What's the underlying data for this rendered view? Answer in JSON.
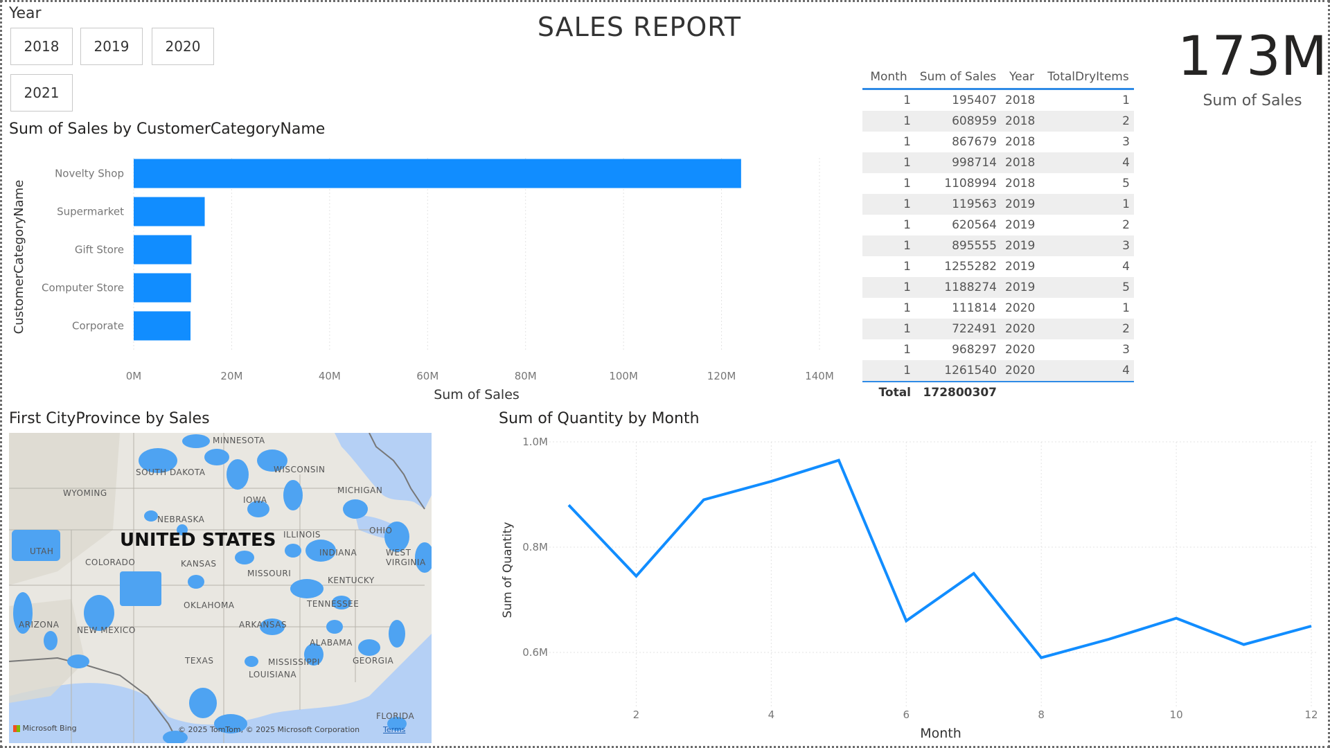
{
  "slicer": {
    "title": "Year",
    "options": [
      "2018",
      "2019",
      "2020",
      "2021"
    ]
  },
  "report": {
    "title": "SALES REPORT"
  },
  "kpi": {
    "value": "173M",
    "label": "Sum of Sales"
  },
  "bar_visual": {
    "title": "Sum of Sales by CustomerCategoryName"
  },
  "table": {
    "headers": [
      "Month",
      "Sum of Sales",
      "Year",
      "TotalDryItems"
    ],
    "rows": [
      [
        "1",
        "195407",
        "2018",
        "1"
      ],
      [
        "1",
        "608959",
        "2018",
        "2"
      ],
      [
        "1",
        "867679",
        "2018",
        "3"
      ],
      [
        "1",
        "998714",
        "2018",
        "4"
      ],
      [
        "1",
        "1108994",
        "2018",
        "5"
      ],
      [
        "1",
        "119563",
        "2019",
        "1"
      ],
      [
        "1",
        "620564",
        "2019",
        "2"
      ],
      [
        "1",
        "895555",
        "2019",
        "3"
      ],
      [
        "1",
        "1255282",
        "2019",
        "4"
      ],
      [
        "1",
        "1188274",
        "2019",
        "5"
      ],
      [
        "1",
        "111814",
        "2020",
        "1"
      ],
      [
        "1",
        "722491",
        "2020",
        "2"
      ],
      [
        "1",
        "968297",
        "2020",
        "3"
      ],
      [
        "1",
        "1261540",
        "2020",
        "4"
      ]
    ],
    "total_label": "Total",
    "total_value": "172800307"
  },
  "map": {
    "title": "First CityProvince by Sales",
    "country_label": "UNITED STATES",
    "state_labels": [
      "MINNESOTA",
      "SOUTH DAKOTA",
      "WISCONSIN",
      "WYOMING",
      "IOWA",
      "MICHIGAN",
      "NEBRASKA",
      "ILLINOIS",
      "OHIO",
      "UTAH",
      "COLORADO",
      "KANSAS",
      "INDIANA",
      "WEST VIRGINIA",
      "MISSOURI",
      "KENTUCKY",
      "OKLAHOMA",
      "TENNESSEE",
      "ARIZONA",
      "NEW MEXICO",
      "ARKANSAS",
      "ALABAMA",
      "TEXAS",
      "MISSISSIPPI",
      "GEORGIA",
      "LOUISIANA",
      "FLORIDA"
    ],
    "logo": "Microsoft Bing",
    "credit": "© 2025 TomTom, © 2025 Microsoft Corporation",
    "terms": "Terms"
  },
  "line_visual": {
    "title": "Sum of Quantity by Month"
  },
  "colors": {
    "accent": "#118dff",
    "header_rule": "#2e8ae6",
    "map_fill": "#4ea3f2"
  },
  "chart_data": [
    {
      "type": "bar",
      "orientation": "horizontal",
      "title": "Sum of Sales by CustomerCategoryName",
      "categories": [
        "Novelty Shop",
        "Supermarket",
        "Gift Store",
        "Computer Store",
        "Corporate"
      ],
      "values": [
        124000000,
        14500000,
        11800000,
        11700000,
        11600000
      ],
      "xlabel": "Sum of Sales",
      "ylabel": "CustomerCategoryName",
      "xlim": [
        0,
        140000000
      ],
      "xticks": [
        "0M",
        "20M",
        "40M",
        "60M",
        "80M",
        "100M",
        "120M",
        "140M"
      ],
      "grid": true
    },
    {
      "type": "line",
      "title": "Sum of Quantity by Month",
      "x": [
        1,
        2,
        3,
        4,
        5,
        6,
        7,
        8,
        9,
        10,
        11,
        12
      ],
      "y": [
        880000,
        745000,
        890000,
        925000,
        965000,
        660000,
        750000,
        590000,
        625000,
        665000,
        615000,
        650000
      ],
      "xlabel": "Month",
      "ylabel": "Sum of Quantity",
      "xlim": [
        1,
        12
      ],
      "ylim": [
        0.5,
        1.0
      ],
      "xticks": [
        "2",
        "4",
        "6",
        "8",
        "10",
        "12"
      ],
      "yticks": [
        "0.6M",
        "0.8M",
        "1.0M"
      ],
      "grid": true
    }
  ]
}
